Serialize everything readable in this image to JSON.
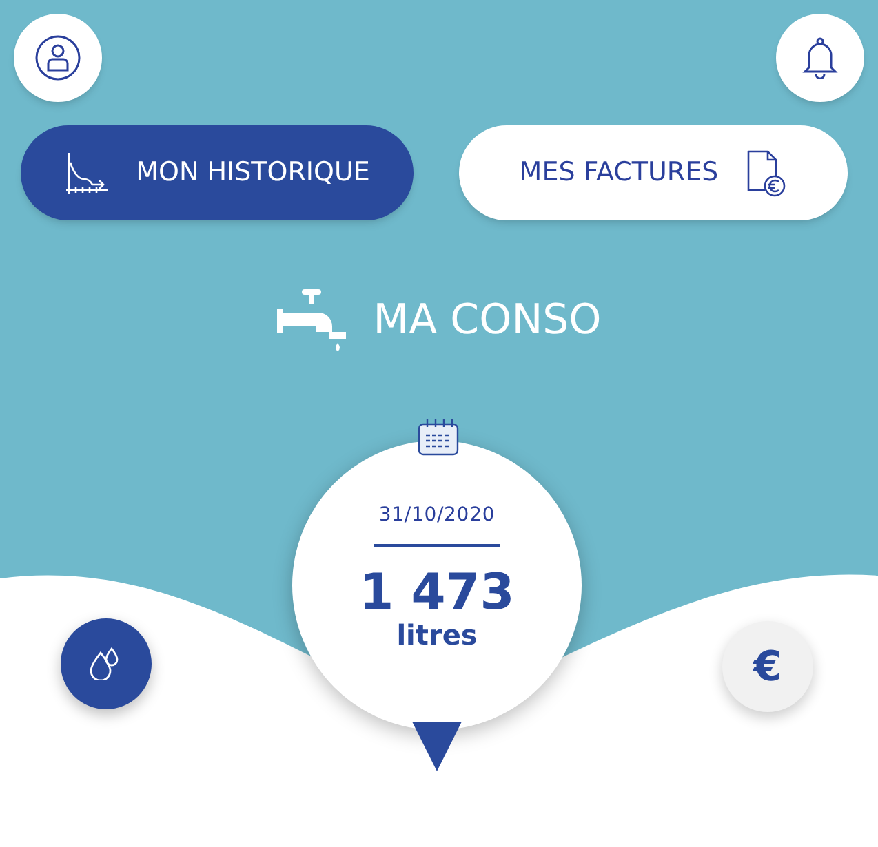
{
  "tabs": [
    {
      "label": "MON HISTORIQUE",
      "kind": "history",
      "selected": true
    },
    {
      "label": "MES FACTURES",
      "kind": "invoices",
      "selected": false
    }
  ],
  "heading": "MA CONSO",
  "reading": {
    "date": "31/10/2020",
    "value": "1 473",
    "unit": "litres"
  },
  "modes": [
    {
      "kind": "water",
      "selected": true
    },
    {
      "kind": "euro",
      "symbol": "€",
      "selected": false
    }
  ]
}
